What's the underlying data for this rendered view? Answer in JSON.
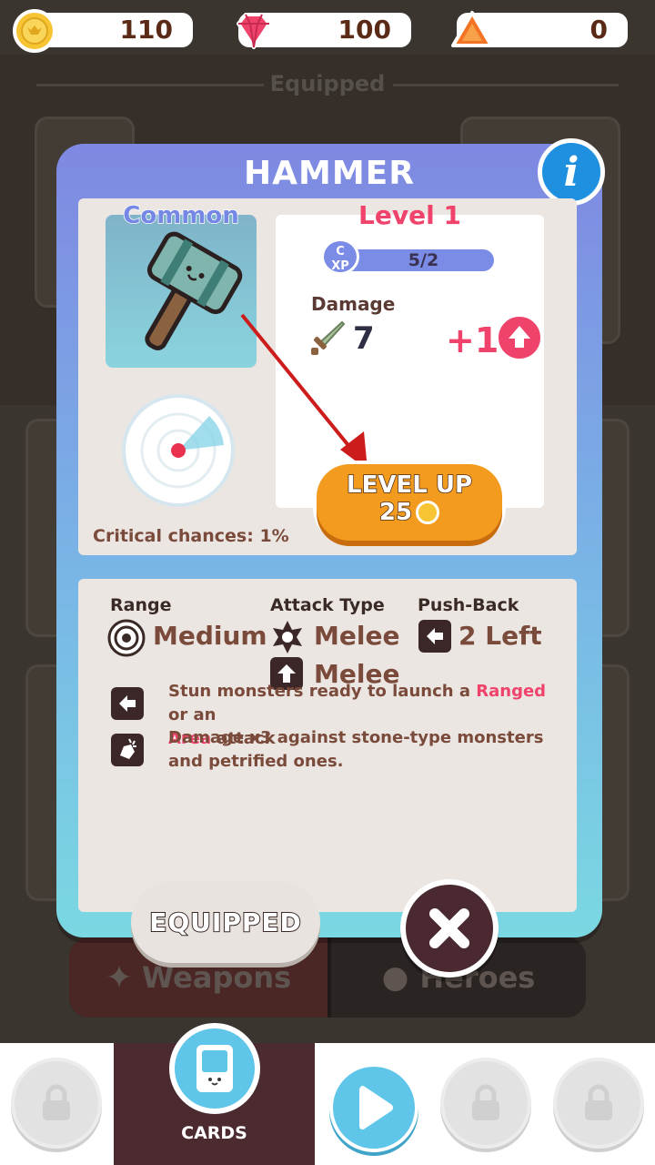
{
  "currency": {
    "coins": "110",
    "gems": "100",
    "tokens": "0"
  },
  "background": {
    "section_label": "Equipped",
    "tabs": [
      {
        "label": "Weapons",
        "icon": "weapon-icon"
      },
      {
        "label": "Heroes",
        "icon": "hero-icon"
      }
    ]
  },
  "modal": {
    "title": "HAMMER",
    "rarity": "Common",
    "level": "Level 1",
    "xp_badge_letter": "C",
    "xp_badge_label": "XP",
    "xp_progress": "5/2",
    "damage_label": "Damage",
    "damage_value": "7",
    "damage_increase": "+1",
    "level_up_label": "LEVEL UP",
    "level_up_cost": "25",
    "critical": "Critical chances: 1%",
    "range_label": "Range",
    "range_value": "Medium",
    "attack_type_label": "Attack Type",
    "attack_type_values": [
      "Melee",
      "Melee"
    ],
    "pushback_label": "Push-Back",
    "pushback_value": "2 Left",
    "abilities": [
      {
        "icon": "arrow-left-icon",
        "parts": [
          "Stun monsters ready to launch a ",
          "Ranged",
          " or an ",
          "Area",
          " attack"
        ]
      },
      {
        "icon": "rock-smash-icon",
        "text": "Damage x3 against stone-type monsters and petrified ones."
      }
    ],
    "equipped_label": "EQUIPPED"
  },
  "nav": {
    "active_label": "CARDS"
  },
  "colors": {
    "accent_pink": "#f0436b",
    "level_up_orange": "#f39b1e",
    "nav_active": "#4b2a30",
    "rarity_text": "#7688e6"
  }
}
